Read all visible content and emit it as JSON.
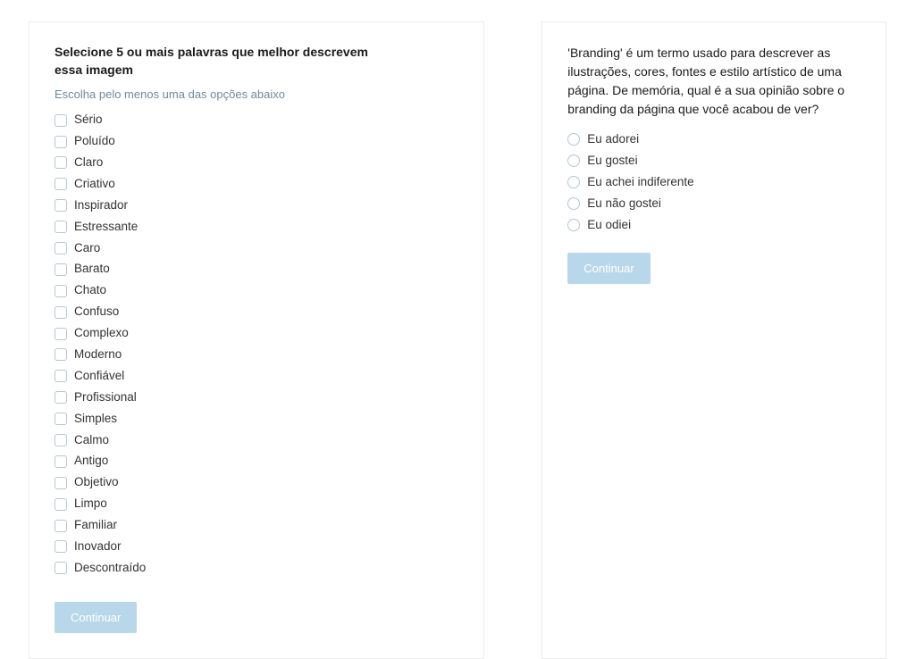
{
  "left_panel": {
    "title": "Selecione 5 ou mais palavras que melhor descrevem essa imagem",
    "instruction": "Escolha pelo menos uma das opções abaixo",
    "options": [
      "Sério",
      "Poluído",
      "Claro",
      "Criativo",
      "Inspirador",
      "Estressante",
      "Caro",
      "Barato",
      "Chato",
      "Confuso",
      "Complexo",
      "Moderno",
      "Confiável",
      "Profissional",
      "Simples",
      "Calmo",
      "Antigo",
      "Objetivo",
      "Limpo",
      "Familiar",
      "Inovador",
      "Descontraído"
    ],
    "button_label": "Continuar"
  },
  "right_panel": {
    "title": "'Branding' é um termo usado para descrever as ilustrações, cores, fontes e estilo artístico de uma página. De memória, qual é a sua opinião sobre o branding da página que você acabou de ver?",
    "options": [
      "Eu adorei",
      "Eu gostei",
      "Eu achei indiferente",
      "Eu não gostei",
      "Eu odiei"
    ],
    "button_label": "Continuar"
  }
}
